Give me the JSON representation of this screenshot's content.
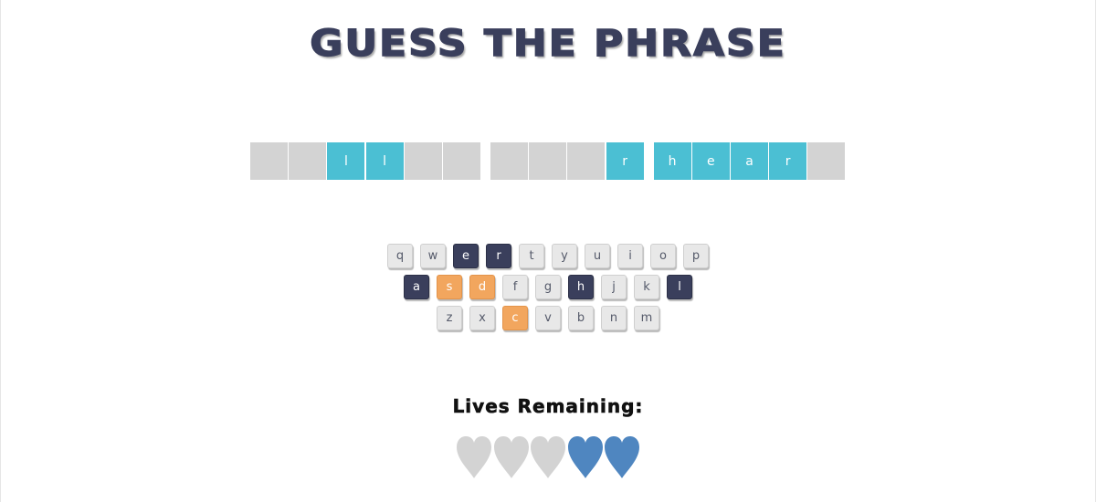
{
  "game": {
    "title": "GUESS THE PHRASE",
    "lives_label": "Lives Remaining:",
    "colors": {
      "title": "#3a3f5c",
      "tile_hidden": "#d3d3d3",
      "tile_revealed": "#4bbfd3",
      "key_default": "#e8e8e8",
      "key_correct": "#3a3f5c",
      "key_wrong": "#f2a65e",
      "heart_lost": "#d3d3d3",
      "heart_remaining": "#4f86c0"
    }
  },
  "phrase": {
    "words": [
      [
        {
          "letter": "",
          "revealed": false
        },
        {
          "letter": "",
          "revealed": false
        },
        {
          "letter": "l",
          "revealed": true
        },
        {
          "letter": "l",
          "revealed": true
        },
        {
          "letter": "",
          "revealed": false
        },
        {
          "letter": "",
          "revealed": false
        }
      ],
      [
        {
          "letter": "",
          "revealed": false
        },
        {
          "letter": "",
          "revealed": false
        },
        {
          "letter": "",
          "revealed": false
        },
        {
          "letter": "r",
          "revealed": true
        }
      ],
      [
        {
          "letter": "h",
          "revealed": true
        },
        {
          "letter": "e",
          "revealed": true
        },
        {
          "letter": "a",
          "revealed": true
        },
        {
          "letter": "r",
          "revealed": true
        },
        {
          "letter": "",
          "revealed": false
        }
      ]
    ]
  },
  "keyboard": {
    "rows": [
      [
        {
          "key": "q",
          "state": "default"
        },
        {
          "key": "w",
          "state": "default"
        },
        {
          "key": "e",
          "state": "chosen"
        },
        {
          "key": "r",
          "state": "chosen"
        },
        {
          "key": "t",
          "state": "default"
        },
        {
          "key": "y",
          "state": "default"
        },
        {
          "key": "u",
          "state": "default"
        },
        {
          "key": "i",
          "state": "default"
        },
        {
          "key": "o",
          "state": "default"
        },
        {
          "key": "p",
          "state": "default"
        }
      ],
      [
        {
          "key": "a",
          "state": "chosen"
        },
        {
          "key": "s",
          "state": "wrong"
        },
        {
          "key": "d",
          "state": "wrong"
        },
        {
          "key": "f",
          "state": "default"
        },
        {
          "key": "g",
          "state": "default"
        },
        {
          "key": "h",
          "state": "chosen"
        },
        {
          "key": "j",
          "state": "default"
        },
        {
          "key": "k",
          "state": "default"
        },
        {
          "key": "l",
          "state": "chosen"
        }
      ],
      [
        {
          "key": "z",
          "state": "default"
        },
        {
          "key": "x",
          "state": "default"
        },
        {
          "key": "c",
          "state": "wrong"
        },
        {
          "key": "v",
          "state": "default"
        },
        {
          "key": "b",
          "state": "default"
        },
        {
          "key": "n",
          "state": "default"
        },
        {
          "key": "m",
          "state": "default"
        }
      ]
    ]
  },
  "lives": {
    "total": 5,
    "remaining": 2,
    "hearts": [
      "lost",
      "lost",
      "lost",
      "remaining",
      "remaining"
    ]
  }
}
